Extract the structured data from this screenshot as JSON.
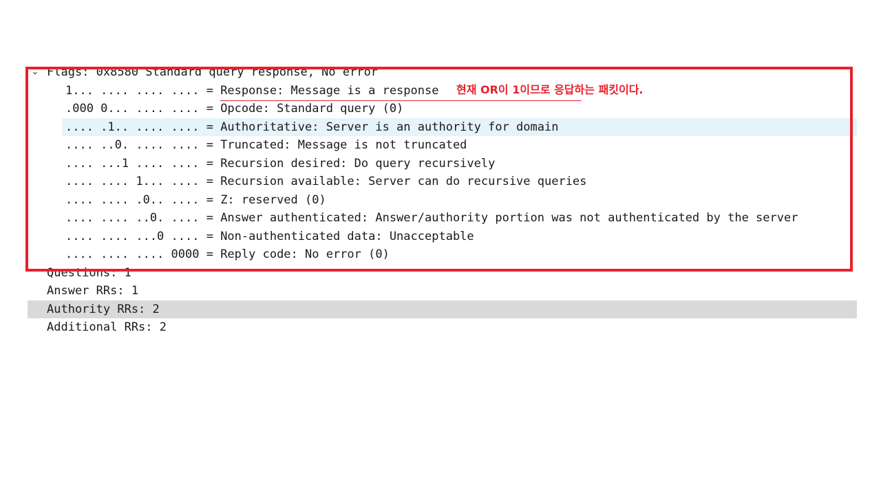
{
  "flags_header": {
    "expander": "⌄",
    "text": "Flags: 0x8580 Standard query response, No error"
  },
  "flag_rows": [
    {
      "bits": "1... .... .... ....",
      "desc": "Response: Message is a response"
    },
    {
      "bits": ".000 0... .... ....",
      "desc": "Opcode: Standard query (0)"
    },
    {
      "bits": ".... .1.. .... ....",
      "desc": "Authoritative: Server is an authority for domain"
    },
    {
      "bits": ".... ..0. .... ....",
      "desc": "Truncated: Message is not truncated"
    },
    {
      "bits": ".... ...1 .... ....",
      "desc": "Recursion desired: Do query recursively"
    },
    {
      "bits": ".... .... 1... ....",
      "desc": "Recursion available: Server can do recursive queries"
    },
    {
      "bits": ".... .... .0.. ....",
      "desc": "Z: reserved (0)"
    },
    {
      "bits": ".... .... ..0. ....",
      "desc": "Answer authenticated: Answer/authority portion was not authenticated by the server"
    },
    {
      "bits": ".... .... ...0 ....",
      "desc": "Non-authenticated data: Unacceptable"
    },
    {
      "bits": ".... .... .... 0000",
      "desc": "Reply code: No error (0)"
    }
  ],
  "counts": {
    "questions": "Questions: 1",
    "answer_rrs": "Answer RRs: 1",
    "authority_rrs": "Authority RRs: 2",
    "additional_rrs": "Additional RRs: 2"
  },
  "annotation": {
    "text": "현재 OR이 1이므로 응답하는 패킷이다."
  },
  "colors": {
    "annotation_red": "#e8212c",
    "selected_row_blue": "#e5f3fb",
    "selected_row_gray": "#d9d9d9"
  }
}
